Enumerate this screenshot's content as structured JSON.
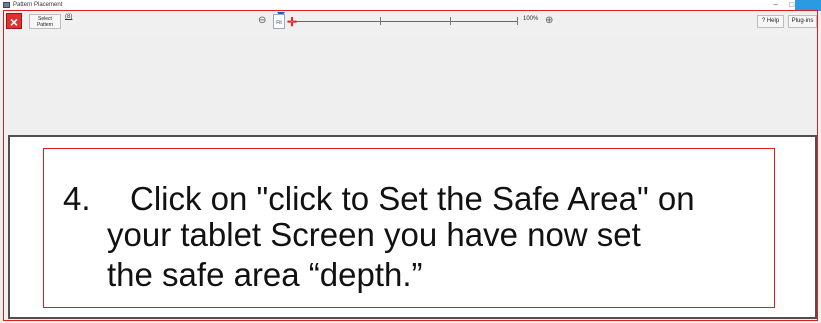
{
  "window": {
    "title": "Pattern Placement",
    "controls": [
      "–",
      "□",
      "×"
    ]
  },
  "toolbar": {
    "close_icon": "×",
    "select_pattern_label": "Select Pattern",
    "small_button_label": "(8)",
    "zoom_out_icon": "⊖",
    "fit_label": "Fit",
    "zoom_handle_icon": "✛",
    "zoom_percent": "100%",
    "zoom_in_icon": "⊕",
    "help_label": "? Help",
    "plugins_label": "Plug-ins"
  },
  "instruction": {
    "number": "4.",
    "line1": "Click on \"click to Set the Safe Area\" on",
    "line2": "your tablet Screen  you have now set",
    "line3": "the safe area “depth.”"
  }
}
